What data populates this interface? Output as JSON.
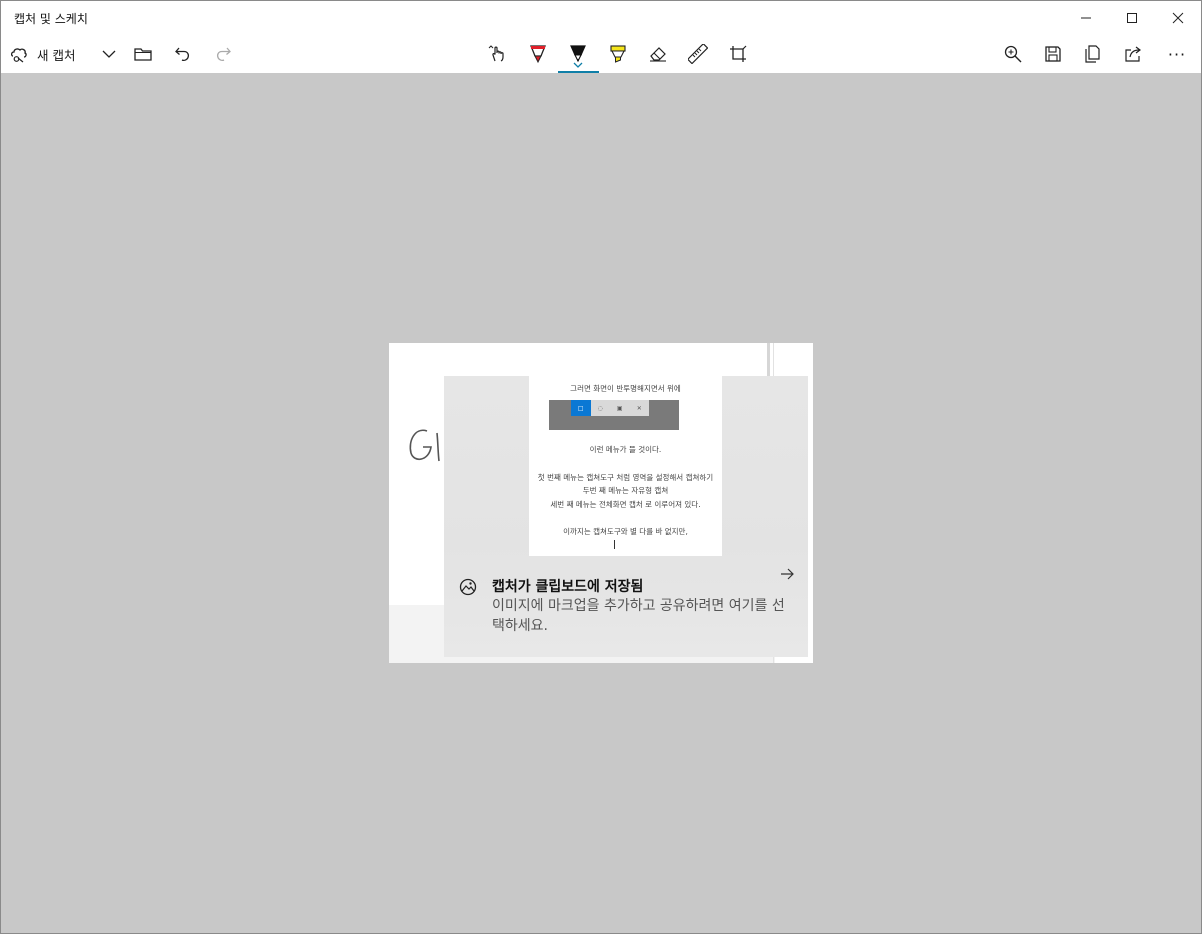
{
  "window": {
    "title": "캡처 및 스케치",
    "controls": [
      "minimize-icon",
      "maximize-icon",
      "close-icon"
    ]
  },
  "toolbar": {
    "new_capture_label": "새 캡처",
    "left_tools": [
      "new-capture-icon",
      "chevron-down-icon",
      "folder-icon",
      "undo-icon",
      "redo-icon"
    ],
    "center_tools": [
      "touch-writing-icon",
      "ballpoint-pen-icon",
      "pencil-icon",
      "highlighter-icon",
      "eraser-icon",
      "ruler-icon",
      "crop-icon"
    ],
    "active_tool": "pencil-icon",
    "right_tools": [
      "zoom-icon",
      "save-icon",
      "copy-icon",
      "share-icon",
      "more-icon"
    ],
    "more_label": "···"
  },
  "capture": {
    "handwriting": "Glacier",
    "document_lines": [
      "그러면 화면이 반투명해지면서 위에",
      "이런 메뉴가 뜰 것이다.",
      "첫 번째 메뉴는 캡쳐도구 처럼 영역을 설정해서 캡쳐하기",
      "두번 째 메뉴는 자유형 캡쳐",
      "세번 째 메뉴는 전체화면 캡처 로 이루어져 있다.",
      "이까지는 캡쳐도구와 별 다를 바 없지만,"
    ],
    "mini_toolbar_icons": [
      "□",
      "◌",
      "▣",
      "✕"
    ],
    "toast": {
      "title": "캡처가 클립보드에 저장됨",
      "body": "이미지에 마크업을 추가하고 공유하려면 여기를 선택하세요."
    }
  },
  "colors": {
    "canvas_background": "#c8c8c8",
    "accent_underline": "#0f7fa8",
    "ballpoint_red": "#e0202a",
    "highlighter_yellow": "#f5e51b"
  }
}
